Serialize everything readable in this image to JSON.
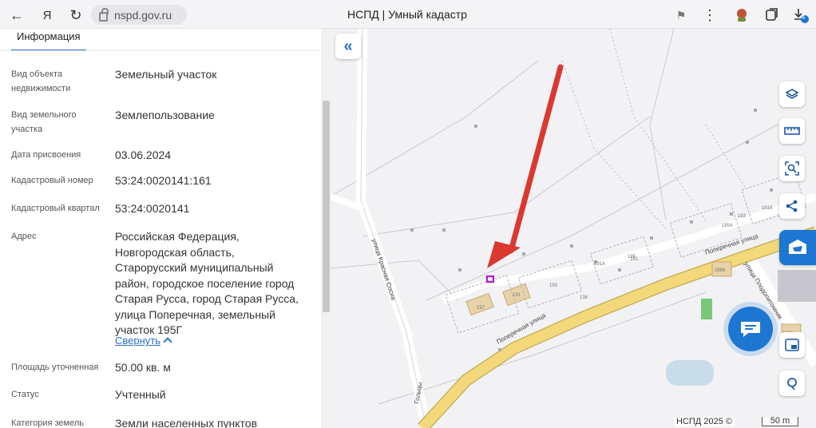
{
  "browser": {
    "url": "nspd.gov.ru",
    "title": "НСПД | Умный кадастр",
    "download_badge": "4"
  },
  "panel": {
    "tab": "Информация",
    "rows": [
      {
        "label": "Вид объекта недвижимости",
        "value": "Земельный участок"
      },
      {
        "label": "Вид земельного участка",
        "value": "Землепользование"
      },
      {
        "label": "Дата присвоения",
        "value": "03.06.2024"
      },
      {
        "label": "Кадастровый номер",
        "value": "53:24:0020141:161"
      },
      {
        "label": "Кадастровый квартал",
        "value": "53:24:0020141"
      },
      {
        "label": "Адрес",
        "value": "Российская Федерация, Новгородская область, Старорусский муниципальный район, городское поселение город Старая Русса, город Старая Русса, улица Поперечная, земельный участок 195Г"
      },
      {
        "label": "Площадь уточненная",
        "value": "50.00 кв. м"
      },
      {
        "label": "Статус",
        "value": "Учтенный"
      },
      {
        "label": "Категория земель",
        "value": "Земли населенных пунктов"
      }
    ],
    "collapse_link": "Свернуть"
  },
  "map": {
    "streets": [
      "Поперечная улица",
      "Поперечная улица",
      "улица Красная Сосна",
      "улица Плодопитомник",
      "Гольцы"
    ],
    "parcel_numbers": [
      "197",
      "191",
      "193",
      "191А",
      "1854",
      "183",
      "161",
      "136",
      "195",
      "1686",
      "1684",
      "1686",
      "1616",
      "165"
    ],
    "copyright": "НСПД 2025 ©",
    "scale": "50 m",
    "accent": "#1d76d1",
    "arrow_color": "#d9392f",
    "parcel_color": "#b31ccf",
    "road_color": "#f3d97a"
  }
}
